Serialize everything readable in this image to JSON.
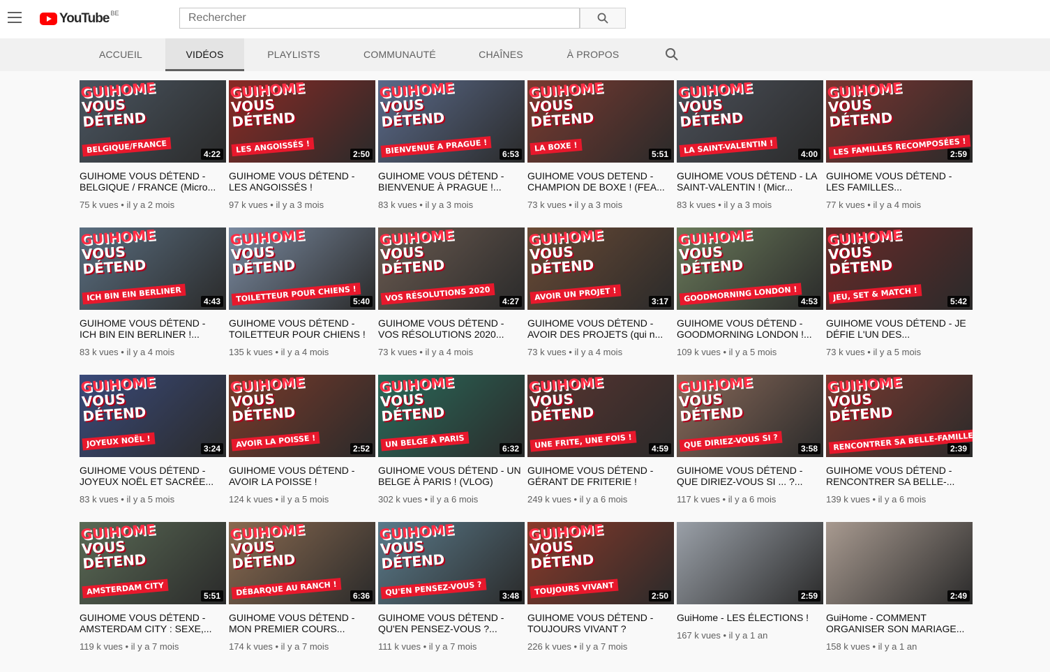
{
  "header": {
    "logo_text": "YouTube",
    "country": "BE",
    "search_placeholder": "Rechercher"
  },
  "tabs": [
    {
      "label": "ACCUEIL"
    },
    {
      "label": "VIDÉOS"
    },
    {
      "label": "PLAYLISTS"
    },
    {
      "label": "COMMUNAUTÉ"
    },
    {
      "label": "CHAÎNES"
    },
    {
      "label": "À PROPOS"
    }
  ],
  "videos": [
    {
      "title": "GUIHOME VOUS DÉTEND - BELGIQUE / FRANCE (Micro...",
      "views": "75 k vues",
      "age": "il y a 2 mois",
      "duration": "4:22",
      "caption": "BELGIQUE/FRANCE",
      "bg": "#4a5560"
    },
    {
      "title": "GUIHOME VOUS DÉTEND - LES ANGOISSÉS !",
      "views": "97 k vues",
      "age": "il y a 3 mois",
      "duration": "2:50",
      "caption": "LES ANGOISSÉS !",
      "bg": "#8a2a25"
    },
    {
      "title": "GUIHOME VOUS DÉTEND - BIENVENUE À PRAGUE !...",
      "views": "83 k vues",
      "age": "il y a 3 mois",
      "duration": "6:53",
      "caption": "BIENVENUE A PRAGUE !",
      "bg": "#5a6a8a"
    },
    {
      "title": "GUIHOME VOUS DETEND - CHAMPION DE BOXE ! (FEA...",
      "views": "73 k vues",
      "age": "il y a 3 mois",
      "duration": "5:51",
      "caption": "LA BOXE !",
      "bg": "#7a3a30"
    },
    {
      "title": "GUIHOME VOUS DÉTEND - LA SAINT-VALENTIN ! (Micr...",
      "views": "83 k vues",
      "age": "il y a 3 mois",
      "duration": "4:00",
      "caption": "LA SAINT-VALENTIN !",
      "bg": "#4a4f58"
    },
    {
      "title": "GUIHOME VOUS DÉTEND - LES FAMILLES...",
      "views": "77 k vues",
      "age": "il y a 4 mois",
      "duration": "2:59",
      "caption": "LES FAMILLES RECOMPOSÉES !",
      "bg": "#7a3530"
    },
    {
      "title": "GUIHOME VOUS DÉTEND - ICH BIN EIN BERLINER !...",
      "views": "83 k vues",
      "age": "il y a 4 mois",
      "duration": "4:43",
      "caption": "ICH BIN EIN BERLINER",
      "bg": "#5a6e80"
    },
    {
      "title": "GUIHOME VOUS DÉTEND - TOILETTEUR POUR CHIENS !",
      "views": "135 k vues",
      "age": "il y a 4 mois",
      "duration": "5:40",
      "caption": "TOILETTEUR POUR CHIENS !",
      "bg": "#7a8aa0"
    },
    {
      "title": "GUIHOME VOUS DÉTEND - VOS RÉSOLUTIONS 2020...",
      "views": "73 k vues",
      "age": "il y a 4 mois",
      "duration": "4:27",
      "caption": "VOS RÉSOLUTIONS 2020",
      "bg": "#6a5a50"
    },
    {
      "title": "GUIHOME VOUS DÉTEND - AVOIR DES PROJETS (qui n...",
      "views": "73 k vues",
      "age": "il y a 4 mois",
      "duration": "3:17",
      "caption": "AVOIR UN PROJET !",
      "bg": "#6a4a35"
    },
    {
      "title": "GUIHOME VOUS DÉTEND - GOODMORNING LONDON !...",
      "views": "109 k vues",
      "age": "il y a 5 mois",
      "duration": "4:53",
      "caption": "GOODMORNING LONDON !",
      "bg": "#6a7a5a"
    },
    {
      "title": "GUIHOME VOUS DÉTEND - JE DÉFIE L'UN DES...",
      "views": "73 k vues",
      "age": "il y a 5 mois",
      "duration": "5:42",
      "caption": "JEU, SET & MATCH !",
      "bg": "#6a2a28"
    },
    {
      "title": "GUIHOME VOUS DÉTEND - JOYEUX NOËL ET SACRÉE...",
      "views": "83 k vues",
      "age": "il y a 5 mois",
      "duration": "3:24",
      "caption": "JOYEUX NOËL !",
      "bg": "#3a4a7a"
    },
    {
      "title": "GUIHOME VOUS DÉTEND - AVOIR LA POISSE !",
      "views": "124 k vues",
      "age": "il y a 5 mois",
      "duration": "2:52",
      "caption": "AVOIR LA POISSE !",
      "bg": "#7a3a2a"
    },
    {
      "title": "GUIHOME VOUS DÉTEND - UN BELGE À PARIS ! (VLOG)",
      "views": "302 k vues",
      "age": "il y a 6 mois",
      "duration": "6:32",
      "caption": "UN BELGE À PARIS",
      "bg": "#2a6a5a"
    },
    {
      "title": "GUIHOME VOUS DÉTEND - GÉRANT DE FRITERIE !",
      "views": "249 k vues",
      "age": "il y a 6 mois",
      "duration": "4:59",
      "caption": "UNE FRITE, UNE FOIS !",
      "bg": "#5a3530"
    },
    {
      "title": "GUIHOME VOUS DÉTEND - QUE DIRIEZ-VOUS SI ... ?...",
      "views": "117 k vues",
      "age": "il y a 6 mois",
      "duration": "3:58",
      "caption": "QUE DIRIEZ-VOUS SI ?",
      "bg": "#8a6a5a"
    },
    {
      "title": "GUIHOME VOUS DÉTEND - RENCONTRER SA BELLE-...",
      "views": "139 k vues",
      "age": "il y a 6 mois",
      "duration": "2:39",
      "caption": "RENCONTRER SA BELLE-FAMILLE !",
      "bg": "#7a3a30"
    },
    {
      "title": "GUIHOME VOUS DÉTEND - AMSTERDAM CITY : SEXE,...",
      "views": "119 k vues",
      "age": "il y a 7 mois",
      "duration": "5:51",
      "caption": "AMSTERDAM CITY",
      "bg": "#5a6a55"
    },
    {
      "title": "GUIHOME VOUS DÉTEND - MON PREMIER COURS...",
      "views": "174 k vues",
      "age": "il y a 7 mois",
      "duration": "6:36",
      "caption": "DÉBARQUE AU RANCH !",
      "bg": "#8a6a50"
    },
    {
      "title": "GUIHOME VOUS DÉTEND - QU'EN PENSEZ-VOUS ?...",
      "views": "111 k vues",
      "age": "il y a 7 mois",
      "duration": "3:48",
      "caption": "QU'EN PENSEZ-VOUS ?",
      "bg": "#5a7a8a"
    },
    {
      "title": "GUIHOME VOUS DÉTEND - TOUJOURS VIVANT ?",
      "views": "226 k vues",
      "age": "il y a 7 mois",
      "duration": "2:50",
      "caption": "TOUJOURS VIVANT",
      "bg": "#8a3a2a"
    },
    {
      "title": "GuiHome - LES ÉLECTIONS !",
      "views": "167 k vues",
      "age": "il y a 1 an",
      "duration": "2:59",
      "caption": "",
      "bg": "#9aa0a8"
    },
    {
      "title": "GuiHome - COMMENT ORGANISER SON MARIAGE...",
      "views": "158 k vues",
      "age": "il y a 1 an",
      "duration": "2:49",
      "caption": "",
      "bg": "#a89a90"
    }
  ],
  "badge_line1": "GUIHOME",
  "badge_line2": "VOUS",
  "badge_line3": "DÉTEND"
}
